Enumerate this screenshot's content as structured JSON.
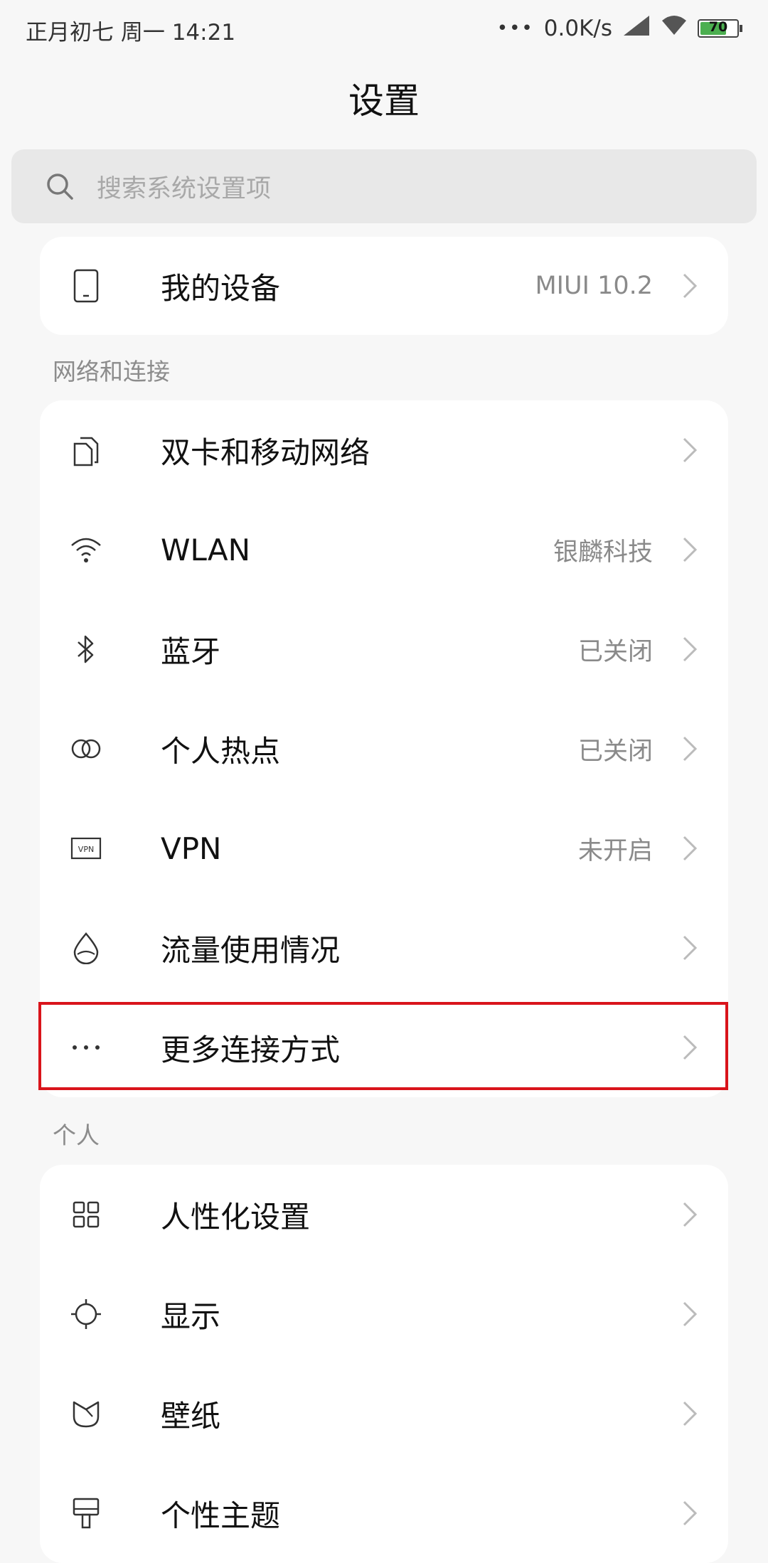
{
  "status_bar": {
    "left_text": "正月初七 周一 14:21",
    "dots": "•••",
    "net_speed": "0.0K/s",
    "battery": "70",
    "battery_color": "#4caf50"
  },
  "title": "设置",
  "search": {
    "placeholder": "搜索系统设置项"
  },
  "my_device": {
    "label": "我的设备",
    "value": "MIUI 10.2",
    "icon": "phone-icon"
  },
  "sections": [
    {
      "header": "网络和连接",
      "items": [
        {
          "label": "双卡和移动网络",
          "value": "",
          "icon": "sim-cards-icon"
        },
        {
          "label": "WLAN",
          "value": "银麟科技",
          "icon": "wifi-icon"
        },
        {
          "label": "蓝牙",
          "value": "已关闭",
          "icon": "bluetooth-icon"
        },
        {
          "label": "个人热点",
          "value": "已关闭",
          "icon": "hotspot-icon"
        },
        {
          "label": "VPN",
          "value": "未开启",
          "icon": "vpn-icon"
        },
        {
          "label": "流量使用情况",
          "value": "",
          "icon": "data-usage-icon"
        },
        {
          "label": "更多连接方式",
          "value": "",
          "icon": "more-icon"
        }
      ]
    },
    {
      "header": "个人",
      "items": [
        {
          "label": "人性化设置",
          "value": "",
          "icon": "grid-icon"
        },
        {
          "label": "显示",
          "value": "",
          "icon": "brightness-icon"
        },
        {
          "label": "壁纸",
          "value": "",
          "icon": "wallpaper-icon"
        },
        {
          "label": "个性主题",
          "value": "",
          "icon": "theme-brush-icon"
        }
      ]
    }
  ],
  "highlight_color": "#d9141b"
}
